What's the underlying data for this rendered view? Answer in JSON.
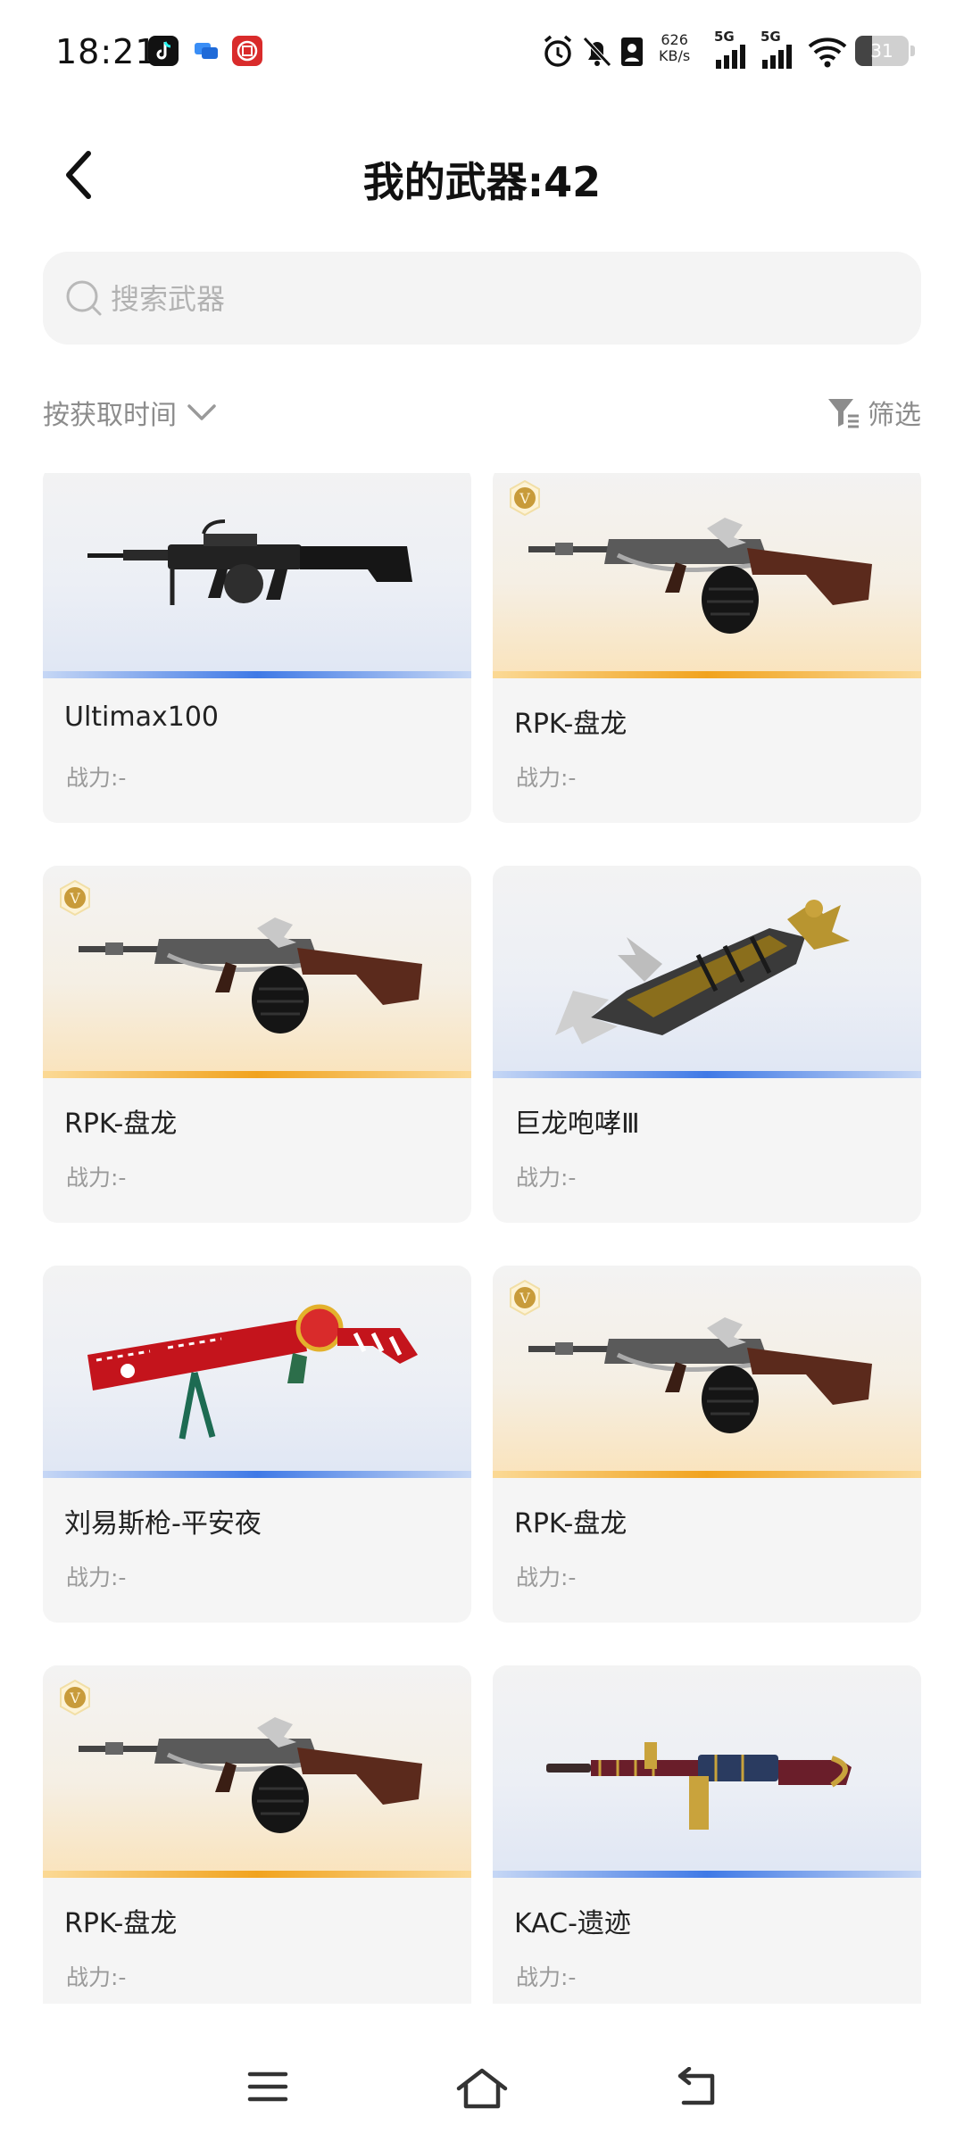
{
  "status_bar": {
    "time": "18:21",
    "net_speed": "626",
    "net_unit": "KB/s",
    "signal_1": "5G",
    "signal_2": "5G",
    "battery": "31",
    "battery_level": 0.31
  },
  "header": {
    "title": "我的武器:42"
  },
  "search": {
    "placeholder": "搜索武器",
    "value": ""
  },
  "toolbar": {
    "sort_label": "按获取时间",
    "filter_label": "筛选"
  },
  "weapons": [
    {
      "name": "Ultimax100",
      "power": "战力:-",
      "rarity": "blue",
      "badge": false,
      "icon": "ultimax-rifle-icon"
    },
    {
      "name": "RPK-盘龙",
      "power": "战力:-",
      "rarity": "gold",
      "badge": true,
      "icon": "rpk-dragon-rifle-icon"
    },
    {
      "name": "RPK-盘龙",
      "power": "战力:-",
      "rarity": "gold",
      "badge": true,
      "icon": "rpk-dragon-rifle-icon"
    },
    {
      "name": "巨龙咆哮Ⅲ",
      "power": "战力:-",
      "rarity": "blue",
      "badge": false,
      "icon": "dragon-cannon-icon"
    },
    {
      "name": "刘易斯枪-平安夜",
      "power": "战力:-",
      "rarity": "blue",
      "badge": false,
      "icon": "lewis-gun-christmas-icon"
    },
    {
      "name": "RPK-盘龙",
      "power": "战力:-",
      "rarity": "gold",
      "badge": true,
      "icon": "rpk-dragon-rifle-icon"
    },
    {
      "name": "RPK-盘龙",
      "power": "战力:-",
      "rarity": "gold",
      "badge": true,
      "icon": "rpk-dragon-rifle-icon"
    },
    {
      "name": "KAC-遗迹",
      "power": "战力:-",
      "rarity": "blue",
      "badge": false,
      "icon": "kac-relic-rifle-icon"
    }
  ],
  "badge_letter": "V",
  "colors": {
    "blue_rarity": "#3f79e6",
    "gold_rarity": "#f1a31e",
    "card_bg": "#f5f5f5",
    "search_bg": "#f4f4f4"
  }
}
